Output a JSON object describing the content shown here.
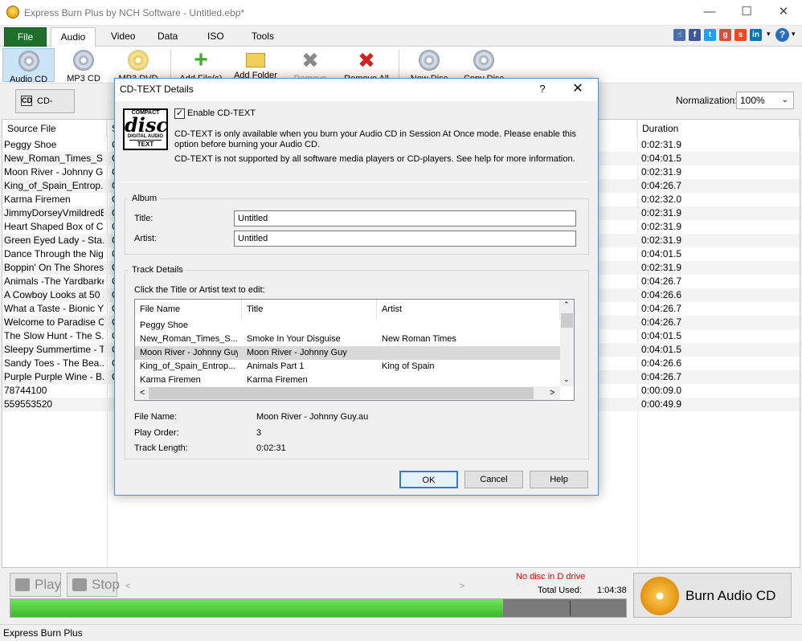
{
  "window": {
    "title": "Express Burn Plus by NCH Software - Untitled.ebp*"
  },
  "menu": {
    "tabs": [
      "File",
      "Audio",
      "Video",
      "Data",
      "ISO",
      "Tools"
    ]
  },
  "ribbon": {
    "buttons": [
      "Audio CD",
      "MP3 CD",
      "MP3 DVD",
      "Add File(s)",
      "Add Folder",
      "Remove",
      "Remove All",
      "New Disc",
      "Copy Disc"
    ]
  },
  "toolbar": {
    "cdtext_label": "CD-TEXT",
    "normalization_label": "Normalization:",
    "normalization_value": "100%"
  },
  "list": {
    "columns": [
      "Source File",
      "S",
      "Duration"
    ],
    "rows": [
      {
        "file": "Peggy Shoe",
        "s": "C",
        "duration": "0:02:31.9"
      },
      {
        "file": "New_Roman_Times_S...",
        "s": "C",
        "duration": "0:04:01.5"
      },
      {
        "file": "Moon River - Johnny Guy",
        "s": "C",
        "duration": "0:02:31.9"
      },
      {
        "file": "King_of_Spain_Entrop...",
        "s": "C",
        "duration": "0:04:26.7"
      },
      {
        "file": "Karma Firemen",
        "s": "C",
        "duration": "0:02:32.0"
      },
      {
        "file": "JimmyDorseyVmildredB...",
        "s": "C",
        "duration": "0:02:31.9"
      },
      {
        "file": "Heart Shaped Box of C...",
        "s": "C",
        "duration": "0:02:31.9"
      },
      {
        "file": "Green Eyed Lady - Sta...",
        "s": "C",
        "duration": "0:02:31.9"
      },
      {
        "file": "Dance Through the Night",
        "s": "C",
        "duration": "0:04:01.5"
      },
      {
        "file": "Boppin' On The Shoreside",
        "s": "C",
        "duration": "0:02:31.9"
      },
      {
        "file": "Animals -The Yardbarkers",
        "s": "C",
        "duration": "0:04:26.7"
      },
      {
        "file": "A Cowboy Looks at 50 ...",
        "s": "C",
        "duration": "0:04:26.6"
      },
      {
        "file": "What a Taste - Bionic Y...",
        "s": "C",
        "duration": "0:04:26.7"
      },
      {
        "file": "Welcome to Paradise City",
        "s": "C",
        "duration": "0:04:26.7"
      },
      {
        "file": "The Slow Hunt - The S...",
        "s": "C",
        "duration": "0:04:01.5"
      },
      {
        "file": "Sleepy Summertime - T...",
        "s": "C",
        "duration": "0:04:01.5"
      },
      {
        "file": "Sandy Toes - The Bea...",
        "s": "C",
        "duration": "0:04:26.6"
      },
      {
        "file": "Purple Purple Wine - B...",
        "s": "C",
        "duration": "0:04:26.7"
      },
      {
        "file": "78744100",
        "s": "",
        "duration": "0:00:09.0"
      },
      {
        "file": "559553520",
        "s": "",
        "duration": "0:00:49.9"
      }
    ]
  },
  "bottom": {
    "play_label": "Play",
    "stop_label": "Stop",
    "status_text": "No disc in D drive",
    "total_used_label": "Total Used:",
    "total_used_value": "1:04:38",
    "burn_label": "Burn Audio CD"
  },
  "statusbar": {
    "text": "Express Burn Plus"
  },
  "dialog": {
    "title": "CD-TEXT Details",
    "help_glyph": "?",
    "logo": {
      "line1": "COMPACT",
      "line2": "disc",
      "line3": "DIGITAL AUDIO",
      "line4": "TEXT"
    },
    "enable_label": "Enable CD-TEXT",
    "info1": "CD-TEXT is only available when you burn your Audio CD in Session At Once mode.  Please enable this option before burning your Audio CD.",
    "info2": "CD-TEXT is not supported by all software media players or CD-players.  See help for more information.",
    "album": {
      "group_label": "Album",
      "title_label": "Title:",
      "title_value": "Untitled",
      "artist_label": "Artist:",
      "artist_value": "Untitled"
    },
    "tracks": {
      "group_label": "Track Details",
      "hint": "Click the Title or Artist text to edit:",
      "columns": [
        "File Name",
        "Title",
        "Artist"
      ],
      "rows": [
        {
          "file": "Peggy Shoe",
          "title": "",
          "artist": ""
        },
        {
          "file": "New_Roman_Times_S...",
          "title": "Smoke In Your Disguise",
          "artist": "New Roman Times"
        },
        {
          "file": "Moon River - Johnny Guy",
          "title": "Moon River - Johnny Guy",
          "artist": ""
        },
        {
          "file": "King_of_Spain_Entrop...",
          "title": "Animals Part 1",
          "artist": "King of Spain"
        },
        {
          "file": "Karma Firemen",
          "title": "Karma Firemen",
          "artist": ""
        }
      ],
      "selected_index": 2,
      "details": {
        "file_name_label": "File Name:",
        "file_name_value": "Moon River - Johnny Guy.au",
        "play_order_label": "Play Order:",
        "play_order_value": "3",
        "track_length_label": "Track Length:",
        "track_length_value": "0:02:31"
      }
    },
    "buttons": {
      "ok": "OK",
      "cancel": "Cancel",
      "help": "Help"
    }
  },
  "progress": {
    "fraction": 0.8
  },
  "colors": {
    "accent_green": "#1e6e2c",
    "status_red": "#e00000",
    "progress_green": "#4fcc3c"
  },
  "icons": [
    "app-flame-icon",
    "minimize-icon",
    "maximize-icon",
    "close-icon",
    "like-icon",
    "facebook-icon",
    "twitter-icon",
    "google-plus-icon",
    "stumbleupon-icon",
    "linkedin-icon",
    "dropdown-icon",
    "help-icon"
  ]
}
